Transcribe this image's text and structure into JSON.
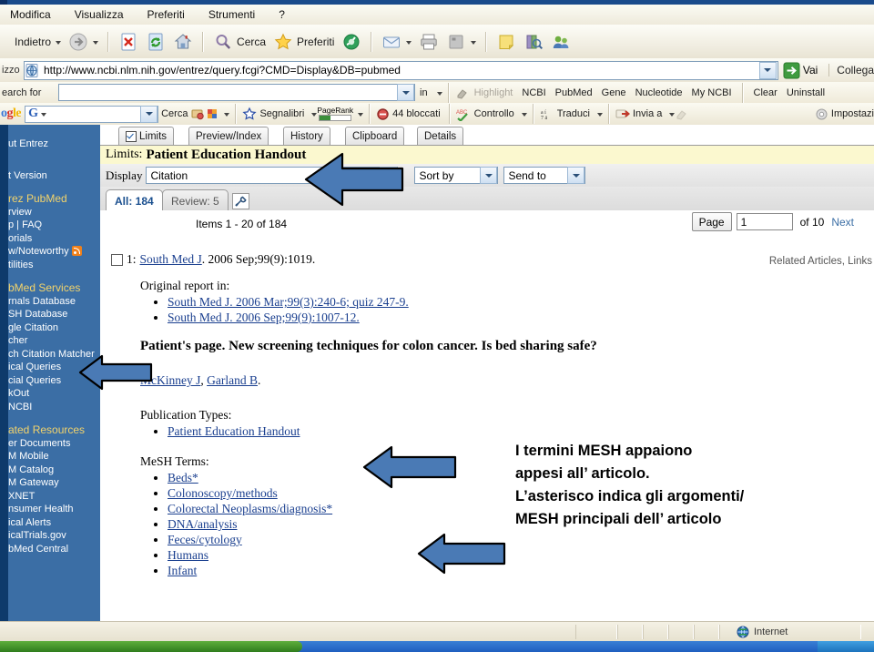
{
  "menubar": {
    "items": [
      "Modifica",
      "Visualizza",
      "Preferiti",
      "Strumenti",
      "?"
    ]
  },
  "toolbar": {
    "back_label": "Indietro",
    "search_label": "Cerca",
    "favorites_label": "Preferiti",
    "icons": [
      "back-icon",
      "forward-icon",
      "stop-icon",
      "refresh-icon",
      "home-icon",
      "search-icon",
      "favorites-star-icon",
      "history-icon",
      "mail-icon",
      "print-icon",
      "edit-icon",
      "notes-icon",
      "research-icon",
      "messenger-icon"
    ]
  },
  "address": {
    "label": "izzo",
    "url": "http://www.ncbi.nlm.nih.gov/entrez/query.fcgi?CMD=Display&DB=pubmed",
    "go_label": "Vai",
    "links_label": "Collega"
  },
  "ncbi_toolbar": {
    "search_label": "earch for",
    "search_value": "",
    "in_label": "in",
    "highlight_label": "Highlight",
    "links": [
      "NCBI",
      "PubMed",
      "Gene",
      "Nucleotide",
      "My NCBI"
    ],
    "clear_label": "Clear",
    "uninstall_label": "Uninstall"
  },
  "google_toolbar": {
    "logo": [
      "o",
      "g",
      "le"
    ],
    "search_value": "",
    "search_label": "Cerca",
    "bookmarks_label": "Segnalibri",
    "pagerank_label": "PageRank",
    "blocked_label": "44 bloccati",
    "spellcheck_label": "Controllo",
    "translate_label": "Traduci",
    "sendto_label": "Invia a",
    "settings_label": "Impostazi"
  },
  "pubmed": {
    "tabs": [
      {
        "label": "Limits",
        "checked": true
      },
      {
        "label": "Preview/Index",
        "checked": false
      },
      {
        "label": "History",
        "checked": false
      },
      {
        "label": "Clipboard",
        "checked": false
      },
      {
        "label": "Details",
        "checked": false
      }
    ],
    "limits_prefix": "Limits:",
    "limits_value": "Patient Education Handout",
    "display_label": "Display",
    "display_value": "Citation",
    "sortby_value": "Sort by",
    "sendto_value": "Send to",
    "result_tabs": [
      {
        "label": "All: 184",
        "active": true
      },
      {
        "label": "Review: 5",
        "active": false
      }
    ],
    "wrench_icon": "wrench-icon",
    "items_line": "Items 1 - 20 of 184",
    "pager": {
      "page_button": "Page",
      "page_value": "1",
      "of_label": "of 10",
      "next_label": "Next"
    },
    "related_links": "Related Articles, Links",
    "citation": {
      "number": "1:",
      "journal": "South Med J",
      "rest": ". 2006 Sep;99(9):1019."
    },
    "original_report_label": "Original report in:",
    "original_reports": [
      "South Med J. 2006 Mar;99(3):240-6; quiz 247-9.",
      "South Med J. 2006 Sep;99(9):1007-12."
    ],
    "article_title": "Patient's page. New screening techniques for colon cancer. Is bed sharing safe?",
    "authors": [
      {
        "name": "McKinney J",
        "sep": ", "
      },
      {
        "name": "Garland B",
        "sep": "."
      }
    ],
    "publication_types_label": "Publication Types:",
    "publication_types": [
      "Patient Education Handout"
    ],
    "mesh_label": "MeSH Terms:",
    "mesh_terms": [
      "Beds*",
      "Colonoscopy/methods",
      "Colorectal Neoplasms/diagnosis*",
      "DNA/analysis",
      "Feces/cytology",
      "Humans",
      "Infant"
    ]
  },
  "sidebar": {
    "items": [
      {
        "type": "link",
        "label": "ut Entrez"
      },
      {
        "type": "gap"
      },
      {
        "type": "link",
        "label": "t Version"
      },
      {
        "type": "group",
        "label": "rez PubMed"
      },
      {
        "type": "link",
        "label": "rview"
      },
      {
        "type": "link",
        "label": "p | FAQ"
      },
      {
        "type": "link",
        "label": "orials"
      },
      {
        "type": "link",
        "label": "w/Noteworthy",
        "rss": true
      },
      {
        "type": "link",
        "label": "tilities"
      },
      {
        "type": "group",
        "label": "bMed Services"
      },
      {
        "type": "link",
        "label": "rnals Database"
      },
      {
        "type": "link",
        "label": "SH Database"
      },
      {
        "type": "link",
        "label": "gle Citation"
      },
      {
        "type": "link",
        "label": "cher"
      },
      {
        "type": "link",
        "label": "ch Citation Matcher"
      },
      {
        "type": "link",
        "label": "ical Queries"
      },
      {
        "type": "link",
        "label": "cial Queries"
      },
      {
        "type": "link",
        "label": "kOut"
      },
      {
        "type": "link",
        "label": "NCBI"
      },
      {
        "type": "group",
        "label": "ated Resources"
      },
      {
        "type": "link",
        "label": "er Documents"
      },
      {
        "type": "link",
        "label": "M Mobile"
      },
      {
        "type": "link",
        "label": "M Catalog"
      },
      {
        "type": "link",
        "label": "M Gateway"
      },
      {
        "type": "link",
        "label": "XNET"
      },
      {
        "type": "link",
        "label": "nsumer Health"
      },
      {
        "type": "link",
        "label": "ical Alerts"
      },
      {
        "type": "link",
        "label": "icalTrials.gov"
      },
      {
        "type": "link",
        "label": "bMed Central"
      }
    ]
  },
  "annotation": {
    "lines": [
      "I termini MESH appaiono",
      "appesi all’ articolo.",
      "L’asterisco indica gli argomenti/",
      "MESH principali dell’ articolo"
    ],
    "arrow_color": "#4a7ab5",
    "arrows": [
      {
        "name": "arrow-display-dropdown"
      },
      {
        "name": "arrow-mesh-database"
      },
      {
        "name": "arrow-publication-type"
      },
      {
        "name": "arrow-mesh-terms"
      }
    ]
  },
  "statusbar": {
    "zone_label": "Internet",
    "zone_icon": "globe-icon"
  }
}
